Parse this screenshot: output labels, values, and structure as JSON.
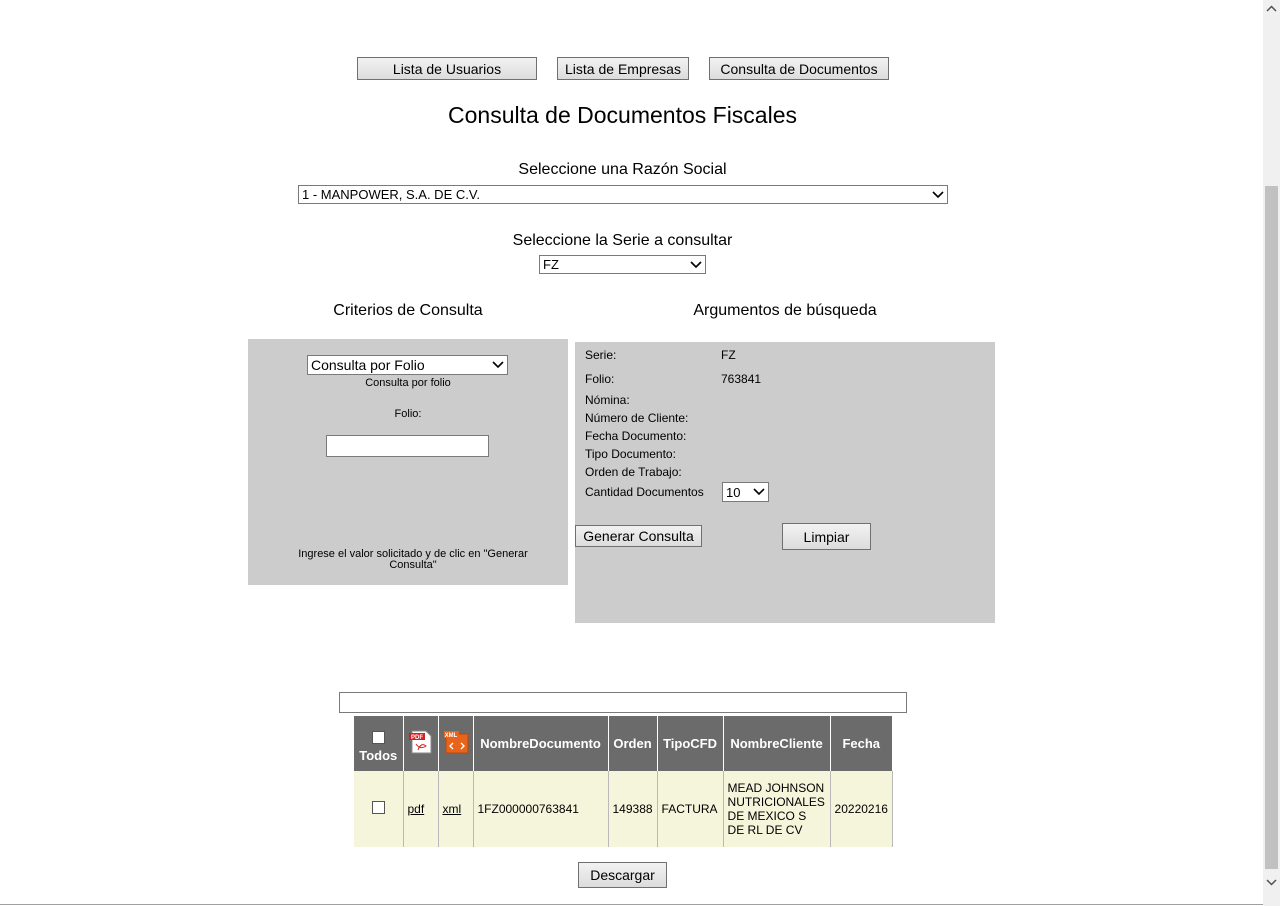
{
  "nav": {
    "users": "Lista de Usuarios",
    "companies": "Lista de Empresas",
    "documents": "Consulta de Documentos"
  },
  "page_title": "Consulta de Documentos Fiscales",
  "razon_social": {
    "label": "Seleccione una Razón Social",
    "selected": "1 - MANPOWER, S.A. DE C.V."
  },
  "serie": {
    "label": "Seleccione la Serie a consultar",
    "selected": "FZ"
  },
  "criterios": {
    "heading": "Criterios de Consulta",
    "selected": "Consulta por Folio",
    "subtitle": "Consulta por folio",
    "folio_label": "Folio:",
    "folio_value": "",
    "hint": "Ingrese el valor solicitado y de clic en \"Generar Consulta\""
  },
  "argumentos": {
    "heading": "Argumentos de búsqueda",
    "serie_label": "Serie:",
    "serie_value": "FZ",
    "folio_label": "Folio:",
    "folio_value": "763841",
    "nomina_label": "Nómina:",
    "cliente_label": "Número de Cliente:",
    "fecha_label": "Fecha Documento:",
    "tipo_label": "Tipo Documento:",
    "orden_label": "Orden de Trabajo:",
    "cantidad_label": "Cantidad Documentos",
    "cantidad_value": "10",
    "generar": "Generar Consulta",
    "limpiar": "Limpiar"
  },
  "results_box": "",
  "table": {
    "headers": {
      "todos": "Todos",
      "pdf_icon_text": "PDF",
      "xml_icon_text": "XML",
      "nombre": "NombreDocumento",
      "orden": "Orden",
      "tipo": "TipoCFD",
      "cliente": "NombreCliente",
      "fecha": "Fecha"
    },
    "rows": [
      {
        "pdf": "pdf",
        "xml": "xml",
        "nombre": "1FZ000000763841",
        "orden": "149388",
        "tipo": "FACTURA",
        "cliente": "MEAD JOHNSON NUTRICIONALES DE MEXICO S DE RL DE CV",
        "fecha": "20220216"
      }
    ]
  },
  "descargar": "Descargar",
  "colors": {
    "panel": "#cccccc",
    "header": "#6b6b6b",
    "row": "#f5f5dc"
  }
}
